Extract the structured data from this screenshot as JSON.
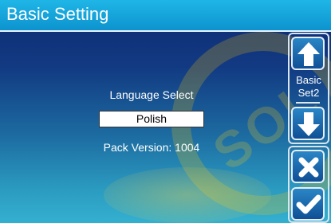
{
  "header": {
    "title": "Basic Setting"
  },
  "main": {
    "language_label": "Language Select",
    "language_value": "Polish",
    "pack_version": "Pack Version: 1004"
  },
  "side_panel": {
    "page_line1": "Basic",
    "page_line2": "Set2",
    "icons": [
      "arrow-up-icon",
      "arrow-down-icon",
      "close-icon",
      "check-icon"
    ]
  },
  "watermark": {
    "text": "SOL"
  },
  "colors": {
    "title_bar": "#0d93cf",
    "background_top": "#0d2a73",
    "background_bottom": "#34b0cf"
  }
}
